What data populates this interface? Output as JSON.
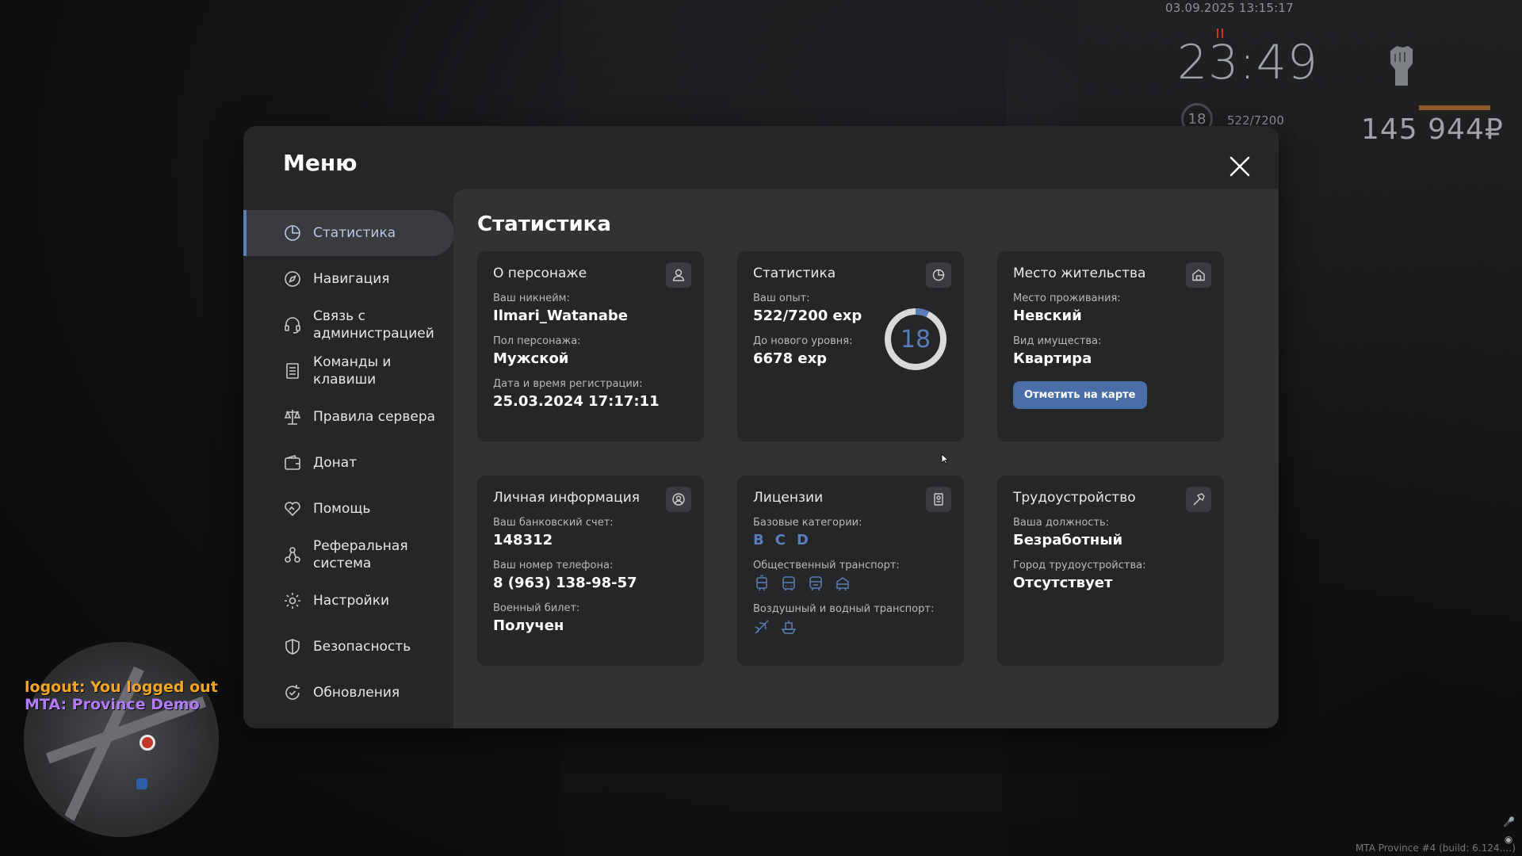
{
  "hud": {
    "datetime": "03.09.2025 13:15:17",
    "time": "23:49",
    "level": "18",
    "exp": "522/7200",
    "money": "145 944₽"
  },
  "chat": {
    "line1": "logout: You logged out",
    "line2": "MTA: Province Demo"
  },
  "build_info": "MTA Province #4 (build: 6.124.…)",
  "menu": {
    "title": "Меню",
    "sidebar": {
      "items": [
        {
          "label": "Статистика",
          "icon": "pie-chart-icon",
          "active": true
        },
        {
          "label": "Навигация",
          "icon": "compass-icon"
        },
        {
          "label": "Связь с администрацией",
          "icon": "headset-icon"
        },
        {
          "label": "Команды и клавиши",
          "icon": "document-list-icon"
        },
        {
          "label": "Правила сервера",
          "icon": "scales-icon"
        },
        {
          "label": "Донат",
          "icon": "wallet-icon"
        },
        {
          "label": "Помощь",
          "icon": "handshake-heart-icon"
        },
        {
          "label": "Реферальная система",
          "icon": "referral-network-icon"
        },
        {
          "label": "Настройки",
          "icon": "gear-icon"
        },
        {
          "label": "Безопасность",
          "icon": "shield-icon"
        },
        {
          "label": "Обновления",
          "icon": "refresh-check-icon"
        }
      ]
    },
    "content": {
      "title": "Статистика",
      "about": {
        "title": "О персонаже",
        "nickname_label": "Ваш никнейм:",
        "nickname": "Ilmari_Watanabe",
        "gender_label": "Пол персонажа:",
        "gender": "Мужской",
        "reg_label": "Дата и время регистрации:",
        "reg": "25.03.2024 17:17:11"
      },
      "stats": {
        "title": "Статистика",
        "exp_label": "Ваш опыт:",
        "exp": "522/7200 exp",
        "next_label": "До нового уровня:",
        "next": "6678 exp",
        "level": "18",
        "progress_fraction": 0.0725
      },
      "residence": {
        "title": "Место жительства",
        "place_label": "Место проживания:",
        "place": "Невский",
        "type_label": "Вид имущества:",
        "type": "Квартира",
        "map_button": "Отметить на карте"
      },
      "personal": {
        "title": "Личная информация",
        "bank_label": "Ваш банковский счет:",
        "bank": "148312",
        "phone_label": "Ваш номер телефона:",
        "phone": "8 (963) 138-98-57",
        "military_label": "Военный билет:",
        "military": "Получен"
      },
      "licenses": {
        "title": "Лицензии",
        "base_label": "Базовые категории:",
        "categories": [
          "B",
          "C",
          "D"
        ],
        "public_label": "Общественный транспорт:",
        "air_label": "Воздушный и водный транспорт:"
      },
      "employment": {
        "title": "Трудоустройство",
        "position_label": "Ваша должность:",
        "position": "Безработный",
        "city_label": "Город трудоустройства:",
        "city": "Отсутствует"
      }
    }
  },
  "colors": {
    "accent": "#5a7db8",
    "button": "#4a6fa8",
    "window_bg": "#252627",
    "content_bg": "#313234"
  }
}
